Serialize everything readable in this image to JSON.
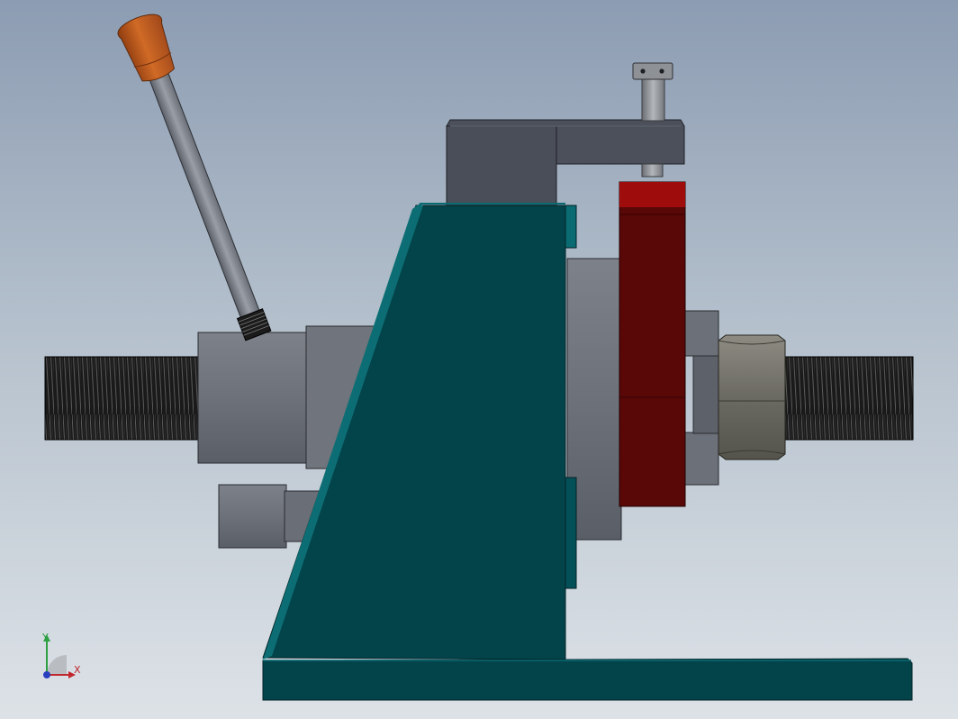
{
  "triad": {
    "x_label": "X",
    "y_label": "Y",
    "x_color": "#c0262c",
    "y_color": "#2ea043",
    "z_color": "#2a3fbf"
  },
  "colors": {
    "base": "#03434a",
    "base_edge": "#0b6b73",
    "steel": "#6c7079",
    "steel_light": "#8f939b",
    "clamp_arm": "#4a4e58",
    "red_block": "#590707",
    "red_top": "#9e0c0c",
    "knob": "#b8561c",
    "nut": "#6a6a62",
    "thread": "#0d0d0d"
  }
}
